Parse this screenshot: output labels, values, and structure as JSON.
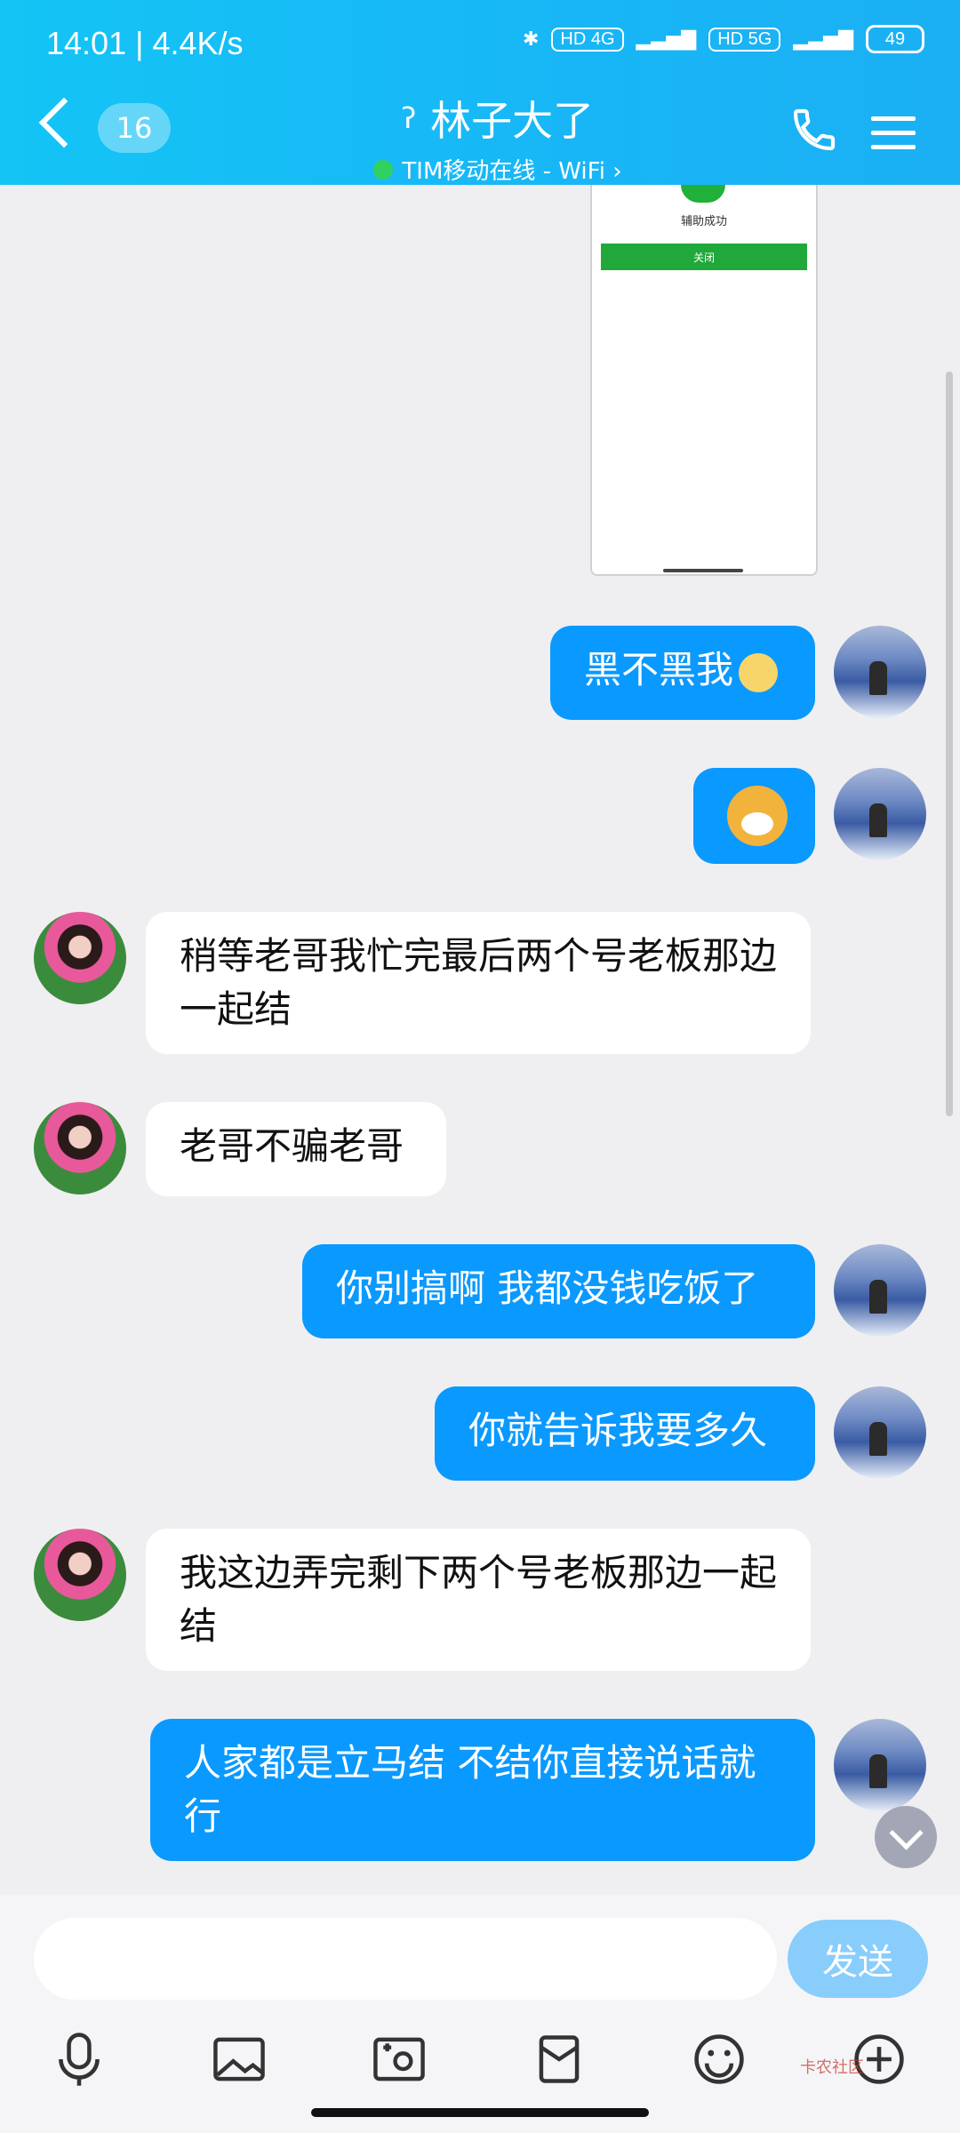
{
  "status_bar": {
    "time": "14:01 | 4.4K/s",
    "network_left": "HD 4G",
    "network_right": "HD 5G",
    "battery": "49"
  },
  "header": {
    "unread_count": "16",
    "title": "林子大了",
    "subtitle": "TIM移动在线 - WiFi ›"
  },
  "shared_screenshot": {
    "message": "辅助成功",
    "button": "关闭"
  },
  "messages": [
    {
      "side": "out",
      "text": "黑不黑我"
    },
    {
      "side": "out",
      "text": ""
    },
    {
      "side": "in",
      "text": "稍等老哥我忙完最后两个号老板那边一起结"
    },
    {
      "side": "in",
      "text": "老哥不骗老哥"
    },
    {
      "side": "out",
      "text": "你别搞啊 我都没钱吃饭了"
    },
    {
      "side": "out",
      "text": "你就告诉我要多久"
    },
    {
      "side": "in",
      "text": "我这边弄完剩下两个号老板那边一起结"
    },
    {
      "side": "out",
      "text": "人家都是立马结 不结你直接说话就行"
    }
  ],
  "composer": {
    "send_label": "发送"
  },
  "toolbar": {
    "icons": [
      "microphone-icon",
      "image-icon",
      "camera-icon",
      "red-packet-icon",
      "emoji-icon",
      "plus-icon"
    ]
  },
  "watermark": "卡农社区"
}
